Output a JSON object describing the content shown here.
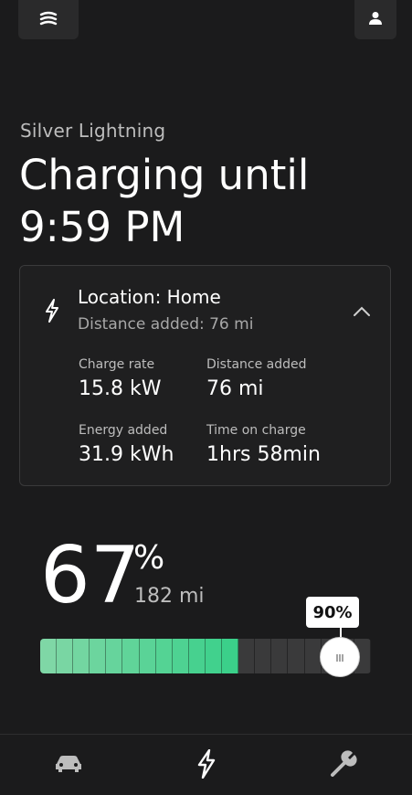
{
  "header": {
    "vehicle_name": "Silver Lightning",
    "headline_line1": "Charging until",
    "headline_line2": "9:59 PM",
    "menu_icon": "menu-icon",
    "profile_icon": "person-icon"
  },
  "card": {
    "location": "Location: Home",
    "distance_summary": "Distance added: 76 mi",
    "stats": [
      {
        "label": "Charge rate",
        "value": "15.8 kW"
      },
      {
        "label": "Distance added",
        "value": "76 mi"
      },
      {
        "label": "Energy added",
        "value": "31.9 kWh"
      },
      {
        "label": "Time on charge",
        "value": "1hrs 58min"
      }
    ]
  },
  "battery": {
    "percent": "67",
    "percent_sign": "%",
    "range": "182 mi",
    "charge_level": 0.67,
    "limit_label": "90%",
    "limit_level": 0.9,
    "fill_colors": [
      "#7fd7a6",
      "#3bd08a"
    ],
    "empty_color": "#3a3a3b"
  },
  "nav": {
    "items": [
      "car-icon",
      "bolt-icon",
      "wrench-icon"
    ],
    "active": "bolt-icon"
  }
}
